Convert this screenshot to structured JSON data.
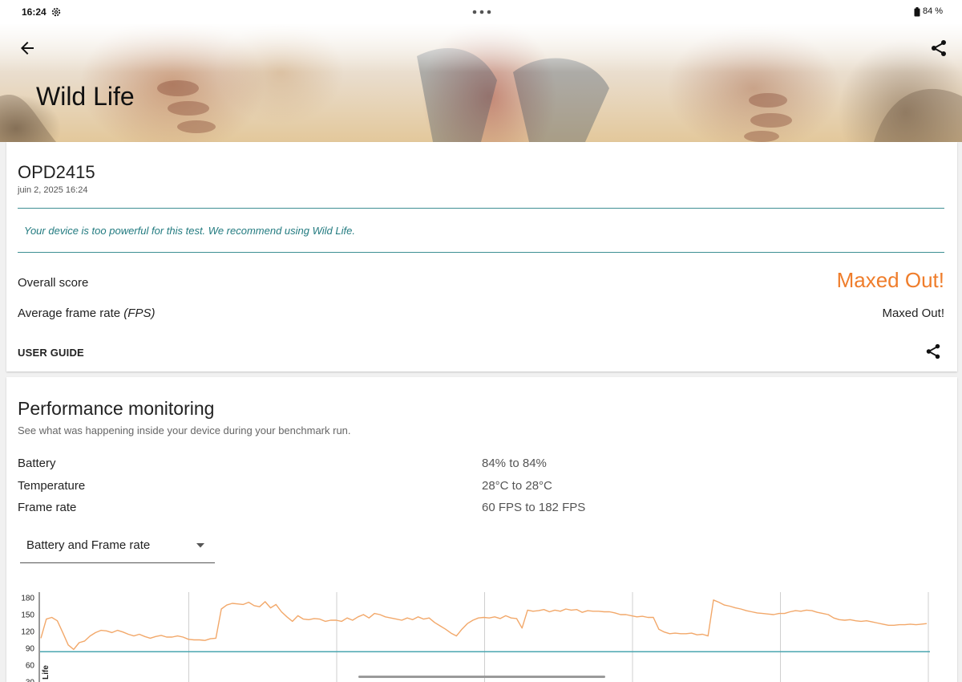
{
  "status_bar": {
    "time": "16:24",
    "battery": "84 %"
  },
  "header": {
    "title": "Wild Life",
    "back_icon": "arrow-back-icon",
    "share_icon": "share-icon"
  },
  "result": {
    "device": "OPD2415",
    "date": "juin 2, 2025 16:24",
    "notice": "Your device is too powerful for this test. We recommend using Wild Life.",
    "overall_label": "Overall score",
    "overall_value": "Maxed Out!",
    "fps_label_main": "Average frame rate",
    "fps_label_unit": "(FPS)",
    "fps_value": "Maxed Out!",
    "user_guide": "USER GUIDE"
  },
  "performance": {
    "title": "Performance monitoring",
    "subtitle": "See what was happening inside your device during your benchmark run.",
    "stats": [
      {
        "label": "Battery",
        "value": "84% to 84%"
      },
      {
        "label": "Temperature",
        "value": "28°C to 28°C"
      },
      {
        "label": "Frame rate",
        "value": "60 FPS to 182 FPS"
      }
    ],
    "dropdown_selected": "Battery and Frame rate"
  },
  "colors": {
    "accent": "#ef7d2b",
    "teal": "#3e8f93",
    "frame_rate_line": "#f2a86a",
    "battery_line": "#4aa6b0"
  },
  "chart_data": {
    "type": "line",
    "y_ticks": [
      "180",
      "150",
      "120",
      "90",
      "60",
      "30"
    ],
    "ylim": [
      30,
      190
    ],
    "axis_partial_label": "Life",
    "segments": 6,
    "series": [
      {
        "values": [
          108,
          142,
          145,
          139,
          118,
          96,
          88,
          100,
          103,
          112,
          118,
          122,
          121,
          118,
          122,
          119,
          115,
          112,
          115,
          111,
          108,
          111,
          113,
          110,
          110,
          112,
          110,
          106,
          105,
          105,
          104,
          107,
          108,
          160,
          167,
          170,
          169,
          168,
          172,
          166,
          164,
          173,
          162,
          168,
          155,
          146,
          138,
          148,
          142,
          141,
          143,
          142,
          138,
          140,
          140,
          138,
          144,
          140,
          146,
          150,
          144,
          152,
          150,
          146,
          144,
          142,
          140,
          144,
          141,
          146,
          142,
          144,
          136,
          130,
          124,
          117,
          112,
          124,
          134,
          140,
          144,
          145,
          144,
          146,
          143,
          148,
          144,
          143,
          126,
          158,
          156,
          157,
          159,
          155,
          158,
          156,
          160,
          158,
          159,
          154,
          157,
          156,
          156,
          155,
          155,
          153,
          150,
          150,
          148,
          146,
          147,
          145,
          145,
          124,
          119,
          116,
          117,
          116,
          116,
          117,
          114,
          115,
          112,
          176,
          172,
          167,
          165,
          162,
          160,
          157,
          155,
          153,
          152,
          151,
          150,
          152,
          152,
          155,
          157,
          156,
          158,
          157,
          154,
          152,
          150,
          144,
          141,
          140,
          141,
          139,
          138,
          139,
          137,
          135,
          133,
          131,
          131,
          132,
          132,
          133,
          132,
          133,
          134
        ]
      },
      {
        "values": [
          84,
          84
        ]
      }
    ]
  }
}
